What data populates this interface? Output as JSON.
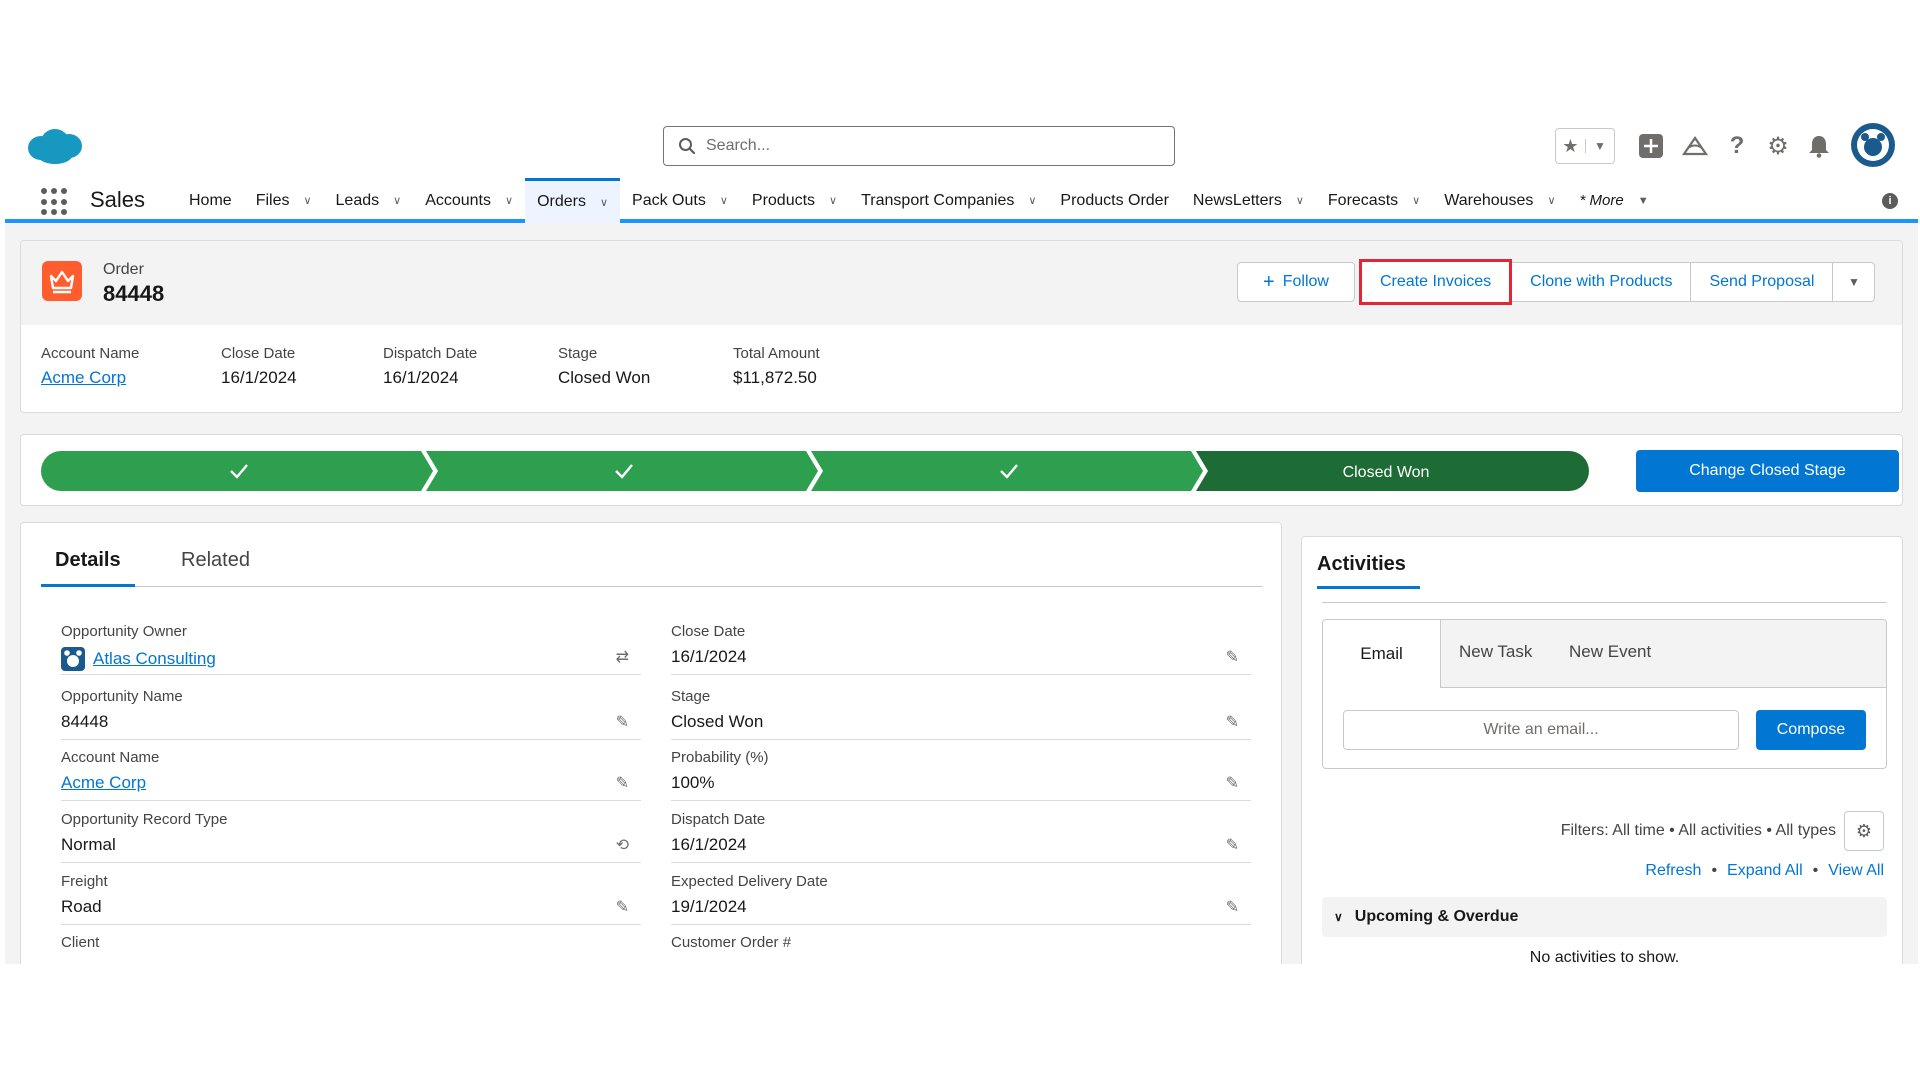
{
  "search": {
    "placeholder": "Search..."
  },
  "app": {
    "name": "Sales"
  },
  "nav": {
    "items": [
      {
        "label": "Home",
        "dropdown": false
      },
      {
        "label": "Files",
        "dropdown": true
      },
      {
        "label": "Leads",
        "dropdown": true
      },
      {
        "label": "Accounts",
        "dropdown": true
      },
      {
        "label": "Orders",
        "dropdown": true,
        "active": true
      },
      {
        "label": "Pack Outs",
        "dropdown": true
      },
      {
        "label": "Products",
        "dropdown": true
      },
      {
        "label": "Transport Companies",
        "dropdown": true
      },
      {
        "label": "Products Order",
        "dropdown": false
      },
      {
        "label": "NewsLetters",
        "dropdown": true
      },
      {
        "label": "Forecasts",
        "dropdown": true
      },
      {
        "label": "Warehouses",
        "dropdown": true
      }
    ],
    "more": "* More"
  },
  "header": {
    "object_label": "Order",
    "title": "84448",
    "actions": {
      "follow": "Follow",
      "create_invoices": "Create Invoices",
      "clone_with_products": "Clone with Products",
      "send_proposal": "Send Proposal"
    },
    "fields": [
      {
        "label": "Account Name",
        "value": "Acme Corp",
        "link": true
      },
      {
        "label": "Close Date",
        "value": "16/1/2024"
      },
      {
        "label": "Dispatch Date",
        "value": "16/1/2024"
      },
      {
        "label": "Stage",
        "value": "Closed Won"
      },
      {
        "label": "Total Amount",
        "value": "$11,872.50"
      }
    ]
  },
  "path": {
    "current_stage": "Closed Won",
    "completed_steps": 3,
    "button": "Change Closed Stage"
  },
  "details": {
    "tabs": {
      "details": "Details",
      "related": "Related"
    },
    "left": [
      {
        "label": "Opportunity Owner",
        "value": "Atlas Consulting",
        "link": true
      },
      {
        "label": "Opportunity Name",
        "value": "84448"
      },
      {
        "label": "Account Name",
        "value": "Acme Corp",
        "link": true
      },
      {
        "label": "Opportunity Record Type",
        "value": "Normal"
      },
      {
        "label": "Freight",
        "value": "Road"
      },
      {
        "label": "Client",
        "value": ""
      }
    ],
    "right": [
      {
        "label": "Close Date",
        "value": "16/1/2024"
      },
      {
        "label": "Stage",
        "value": "Closed Won"
      },
      {
        "label": "Probability (%)",
        "value": "100%"
      },
      {
        "label": "Dispatch Date",
        "value": "16/1/2024"
      },
      {
        "label": "Expected Delivery Date",
        "value": "19/1/2024"
      },
      {
        "label": "Customer Order #",
        "value": ""
      }
    ]
  },
  "activities": {
    "title": "Activities",
    "tabs": {
      "email": "Email",
      "new_task": "New Task",
      "new_event": "New Event"
    },
    "email_placeholder": "Write an email...",
    "compose": "Compose",
    "filters": "Filters: All time • All activities • All types",
    "links": {
      "refresh": "Refresh",
      "expand_all": "Expand All",
      "view_all": "View All"
    },
    "upcoming": "Upcoming & Overdue",
    "empty": "No activities to show."
  },
  "colors": {
    "brand_blue": "#0176d3",
    "path_complete": "#2e9e4f",
    "path_current": "#1d6b35",
    "highlight_red": "#e32636",
    "order_icon": "#ff5d2d"
  }
}
